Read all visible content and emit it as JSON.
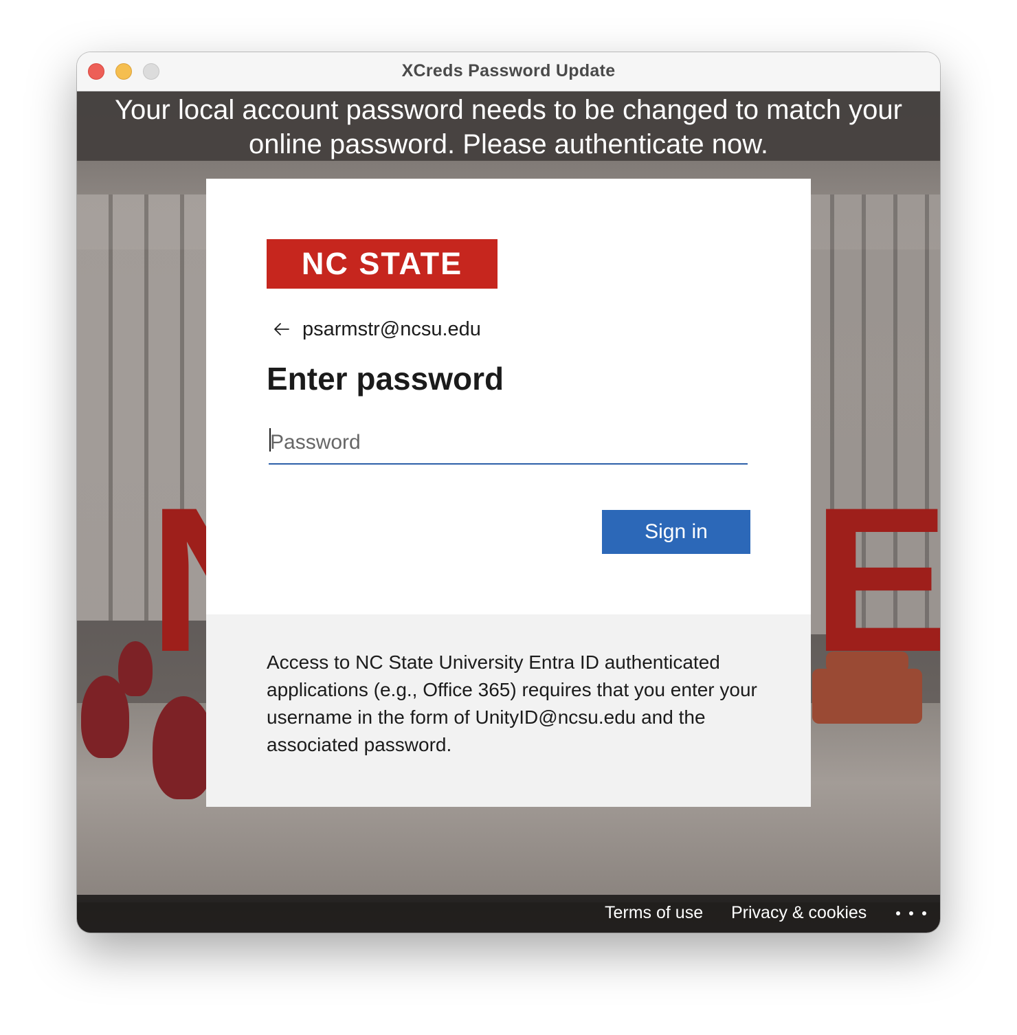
{
  "window": {
    "title": "XCreds Password Update"
  },
  "banner": {
    "line1": "Your local account password needs to be changed to match your",
    "line2": "online password. Please authenticate now."
  },
  "card": {
    "logo_text": "NC STATE",
    "back_icon": "arrow-left-icon",
    "identity": "psarmstr@ncsu.edu",
    "heading": "Enter password",
    "password_placeholder": "Password",
    "password_value": "",
    "signin_label": "Sign in",
    "notice": "Access to NC State University Entra ID authenticated applications (e.g., Office 365) requires that you enter your username in the form of UnityID@ncsu.edu and the associated password."
  },
  "footer": {
    "terms_label": "Terms of use",
    "privacy_label": "Privacy & cookies",
    "more_icon": "ellipsis-icon"
  },
  "background": {
    "letter_left": "N",
    "letter_right": "E"
  },
  "colors": {
    "brand_red": "#c6261e",
    "button_blue": "#2c68b8",
    "input_underline": "#2c5fa8"
  }
}
